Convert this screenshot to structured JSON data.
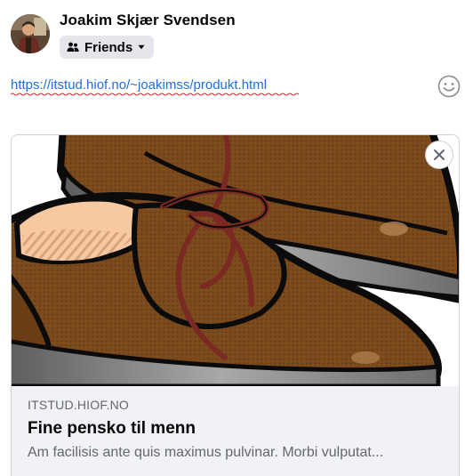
{
  "header": {
    "user_name": "Joakim Skjær Svendsen",
    "audience": {
      "label": "Friends",
      "icon": "friends-icon",
      "caret_icon": "caret-down-icon"
    },
    "avatar_icon": "profile-photo"
  },
  "post": {
    "text": "https://itstud.hiof.no/~joakimss/produkt.html",
    "emoji_icon": "smiley-icon"
  },
  "link_preview": {
    "domain": "ITSTUD.HIOF.NO",
    "title": "Fine pensko til menn",
    "description": "Am facilisis ante quis maximus pulvinar. Morbi vulputat...",
    "image": "brown-shoes-illustration",
    "close_icon": "close-icon"
  },
  "colors": {
    "link": "#216fdb",
    "secondary_text": "#65676b",
    "chip_background": "#e4e6eb",
    "card_footer": "#f0f2f5",
    "shoe_brown": "#7a4a1c"
  }
}
